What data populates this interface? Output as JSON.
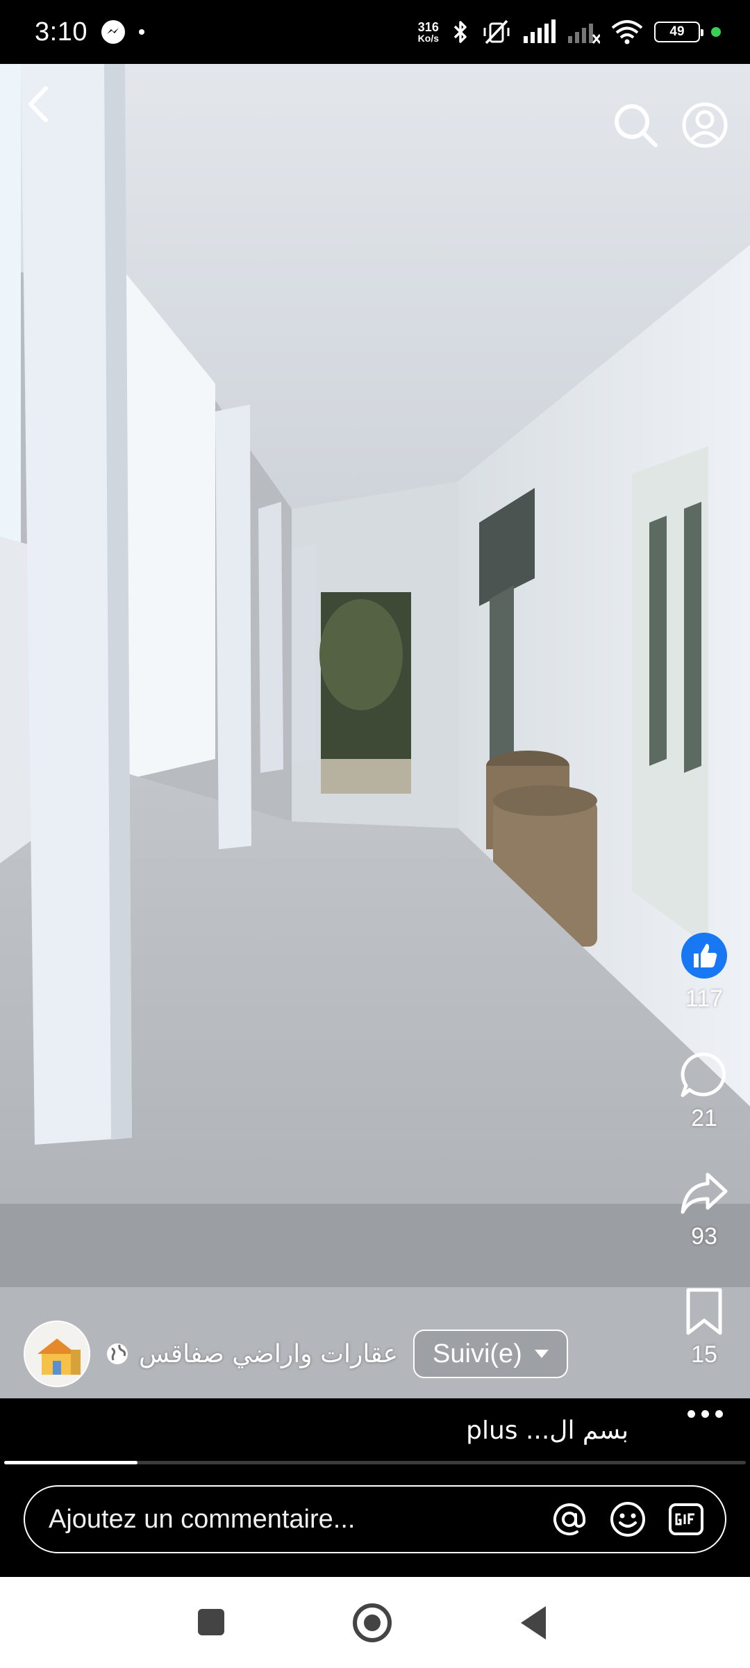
{
  "status_bar": {
    "time": "3:10",
    "net_speed_value": "316",
    "net_speed_unit": "Ko/s",
    "battery": "49",
    "icons": [
      "messenger-icon",
      "bluetooth-icon",
      "vibrate-off-icon",
      "signal-icon",
      "signal-x-icon",
      "wifi-icon",
      "battery-icon"
    ]
  },
  "top_bar": {
    "icons": [
      "back-arrow-icon",
      "search-icon",
      "profile-icon"
    ]
  },
  "actions": {
    "likes": "117",
    "comments": "21",
    "shares": "93",
    "saves": "15"
  },
  "owner": {
    "page_name": "عقارات واراضي صفاقس",
    "follow_label": "Suivi(e)"
  },
  "caption": {
    "text": "بسم ال... plus"
  },
  "video_progress": 0.18,
  "comment": {
    "placeholder": "Ajoutez un commentaire...",
    "icons": [
      "mention-icon",
      "emoji-icon",
      "gif-icon"
    ]
  },
  "colors": {
    "like_blue": "#1877f2",
    "status_green": "#37d158"
  }
}
